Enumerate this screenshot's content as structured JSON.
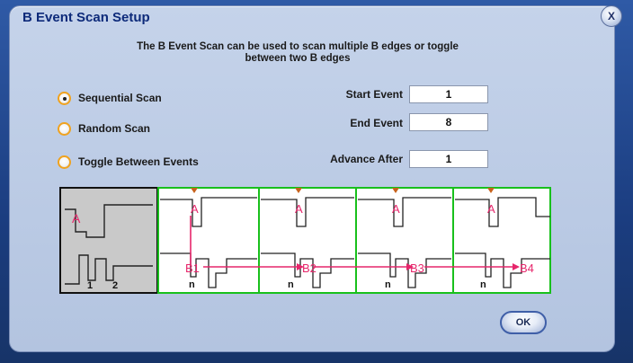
{
  "dialog": {
    "title": "B Event Scan Setup",
    "close_label": "X",
    "description_line1": "The B Event Scan can be used to scan multiple B edges or toggle",
    "description_line2": "between two B edges"
  },
  "scan_modes": [
    {
      "label": "Sequential Scan",
      "selected": true
    },
    {
      "label": "Random Scan",
      "selected": false
    },
    {
      "label": "Toggle Between Events",
      "selected": false
    }
  ],
  "fields": {
    "start_event": {
      "label": "Start Event",
      "value": "1"
    },
    "end_event": {
      "label": "End Event",
      "value": "8"
    },
    "advance_after": {
      "label": "Advance After",
      "value": "1"
    }
  },
  "diagram": {
    "a_label": "A",
    "edge_labels": [
      "1",
      "2"
    ],
    "b_labels": [
      "B1",
      "B2",
      "B3",
      "B4"
    ],
    "n_label": "n"
  },
  "ok_label": "OK",
  "colors": {
    "accent": "#0d2a7a",
    "grid": "#19c01c",
    "marker": "#e6266b",
    "radio_ring": "#f0a21e"
  }
}
